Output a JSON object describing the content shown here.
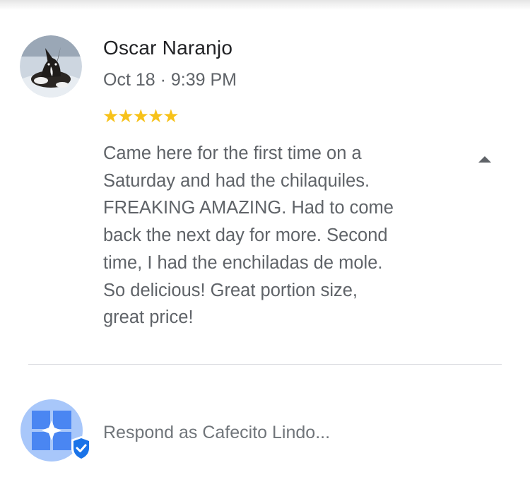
{
  "review": {
    "author": "Oscar Naranjo",
    "date": "Oct 18 · 9:39 PM",
    "stars": "★★★★★",
    "rating": 5,
    "text": "Came here for the first time on a\nSaturday and had the chilaquiles.\nFREAKING AMAZING. Had to come\nback the next day for more. Second\ntime, I had the enchiladas de mole.\nSo delicious! Great portion size,\ngreat price!",
    "collapse_icon": "caret-up-icon"
  },
  "reply": {
    "placeholder": "Respond as Cafecito Lindo...",
    "business_icon": "business-logo-icon",
    "verified_icon": "verified-check-icon"
  },
  "colors": {
    "star": "#f7c21a",
    "name": "#202124",
    "secondary_text": "#5f6368",
    "business_blue": "#4a86f2",
    "verified_blue": "#1a73e8"
  }
}
